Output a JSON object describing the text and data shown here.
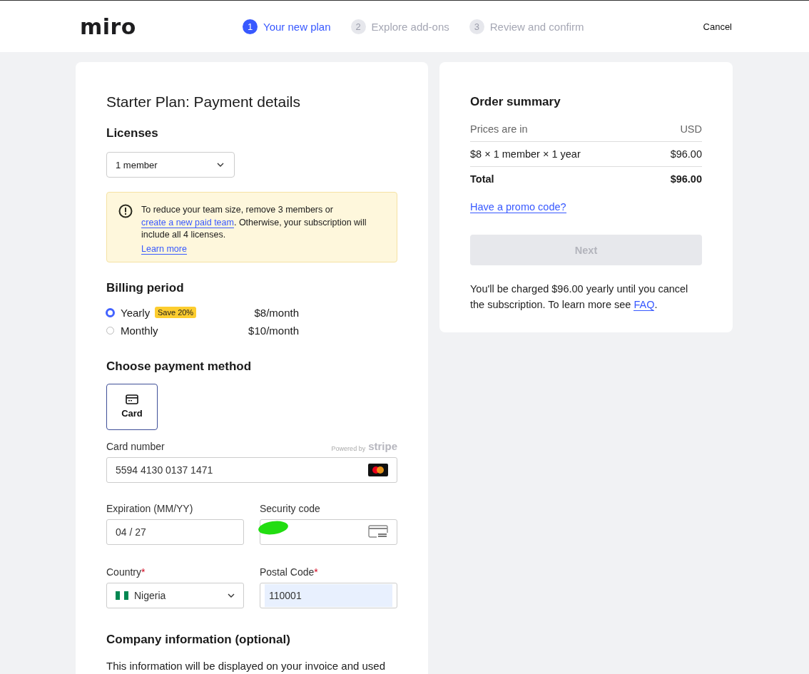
{
  "header": {
    "logo": "miro",
    "steps": [
      {
        "number": "1",
        "label": "Your new plan",
        "selected": true
      },
      {
        "number": "2",
        "label": "Explore add-ons",
        "selected": false
      },
      {
        "number": "3",
        "label": "Review and confirm",
        "selected": false
      }
    ],
    "cancel": "Cancel"
  },
  "payment": {
    "title": "Starter Plan: Payment details",
    "licenses": {
      "heading": "Licenses",
      "value": "1 member"
    },
    "notice": {
      "before": "To reduce your team size, remove 3 members or ",
      "link": "create a new paid team",
      "after": ". Otherwise, your subscription will include all 4 licenses.",
      "learn_more": "Learn more"
    },
    "billing": {
      "heading": "Billing period",
      "options": [
        {
          "label": "Yearly",
          "badge": "Save 20%",
          "price": "$8/month",
          "selected": true
        },
        {
          "label": "Monthly",
          "price": "$10/month",
          "selected": false
        }
      ]
    },
    "method": {
      "heading": "Choose payment method",
      "options": [
        {
          "label": "Card",
          "selected": true
        }
      ]
    },
    "card": {
      "number_label": "Card number",
      "powered_by": "Powered by",
      "stripe": "stripe",
      "number": "5594 4130 0137 1471",
      "expiry_label": "Expiration (MM/YY)",
      "expiry": "04 / 27",
      "security_label": "Security code",
      "country_label": "Country",
      "country_required_mark": "*",
      "country": "Nigeria",
      "postal_label": "Postal Code",
      "postal_required_mark": "*",
      "postal": "110001",
      "postal_autofilled": true
    },
    "company": {
      "heading": "Company information (optional)",
      "text": "This information will be displayed on your invoice and used"
    }
  },
  "summary": {
    "title": "Order summary",
    "rows": [
      {
        "kind": "plain",
        "label": "Prices are in",
        "value": "USD"
      },
      {
        "kind": "line",
        "label": "$8 × 1 member × 1 year",
        "value": "$96.00"
      },
      {
        "kind": "total",
        "label": "Total",
        "value": "$96.00"
      }
    ],
    "promo": "Have a promo code?",
    "next": {
      "label": "Next",
      "disabled": true
    },
    "note": {
      "before": "You'll be charged $96.00 yearly until you cancel the subscription. To learn more see ",
      "link": "FAQ",
      "after": "."
    }
  }
}
